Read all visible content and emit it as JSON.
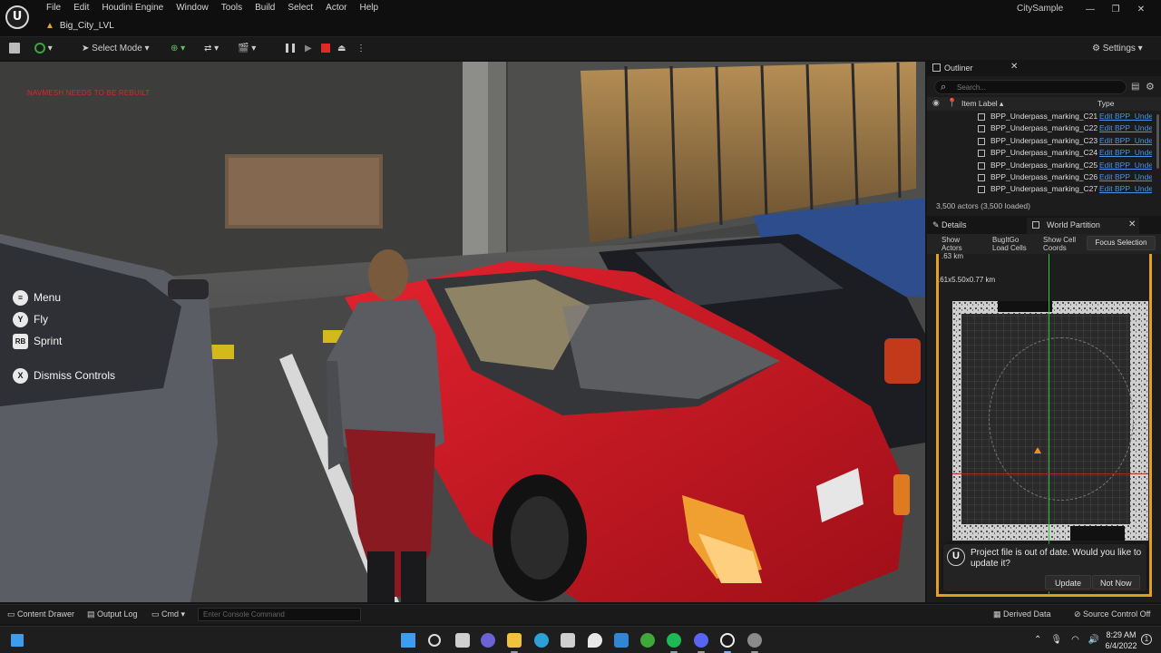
{
  "window": {
    "menu": [
      "File",
      "Edit",
      "Houdini Engine",
      "Window",
      "Tools",
      "Build",
      "Select",
      "Actor",
      "Help"
    ],
    "level_tab": "Big_City_LVL",
    "project_name": "CitySample",
    "controls": [
      "—",
      "❐",
      "✕"
    ]
  },
  "toolbar": {
    "select_mode": "Select Mode",
    "settings": "Settings"
  },
  "viewport": {
    "warning": "NAVMESH NEEDS TO BE REBUILT",
    "hints": [
      {
        "key": "≡",
        "label": "Menu"
      },
      {
        "key": "Y",
        "label": "Fly"
      },
      {
        "key": "RB",
        "label": "Sprint"
      },
      {
        "key": "X",
        "label": "Dismiss Controls"
      }
    ]
  },
  "outliner": {
    "title": "Outliner",
    "search_placeholder": "Search...",
    "col_label": "Item Label ▴",
    "col_type": "Type",
    "rows": [
      {
        "name": "BPP_Underpass_marking_C21",
        "type": "Edit BPP_Unde"
      },
      {
        "name": "BPP_Underpass_marking_C22",
        "type": "Edit BPP_Unde"
      },
      {
        "name": "BPP_Underpass_marking_C23",
        "type": "Edit BPP_Unde"
      },
      {
        "name": "BPP_Underpass_marking_C24",
        "type": "Edit BPP_Unde"
      },
      {
        "name": "BPP_Underpass_marking_C25",
        "type": "Edit BPP_Unde"
      },
      {
        "name": "BPP_Underpass_marking_C26",
        "type": "Edit BPP_Unde"
      },
      {
        "name": "BPP_Underpass_marking_C27",
        "type": "Edit BPP_Unde"
      }
    ],
    "actor_count": "3,500 actors (3,500 loaded)"
  },
  "details": {
    "details_tab": "Details",
    "world_partition_tab": "World Partition",
    "show_actors": "Show\nActors",
    "bugitgo": "BugItGo\nLoad Cells",
    "show_cell": "Show Cell\nCoords",
    "focus_selection": "Focus Selection",
    "scale_readout": ".63 km",
    "size_readout": ".61x5.50x0.77 km"
  },
  "toast": {
    "message": "Project file is out of date. Would you like to update it?",
    "update": "Update",
    "not_now": "Not Now"
  },
  "statusbar": {
    "content_drawer": "Content Drawer",
    "output_log": "Output Log",
    "cmd": "Cmd",
    "console_placeholder": "Enter Console Command",
    "derived_data": "Derived Data",
    "source_control": "Source Control Off"
  },
  "taskbar": {
    "time": "8:29 AM",
    "date": "6/4/2022"
  },
  "colors": {
    "accent_orange": "#e5a021",
    "link_blue": "#4d92e8",
    "warning_red": "#e0242a"
  }
}
